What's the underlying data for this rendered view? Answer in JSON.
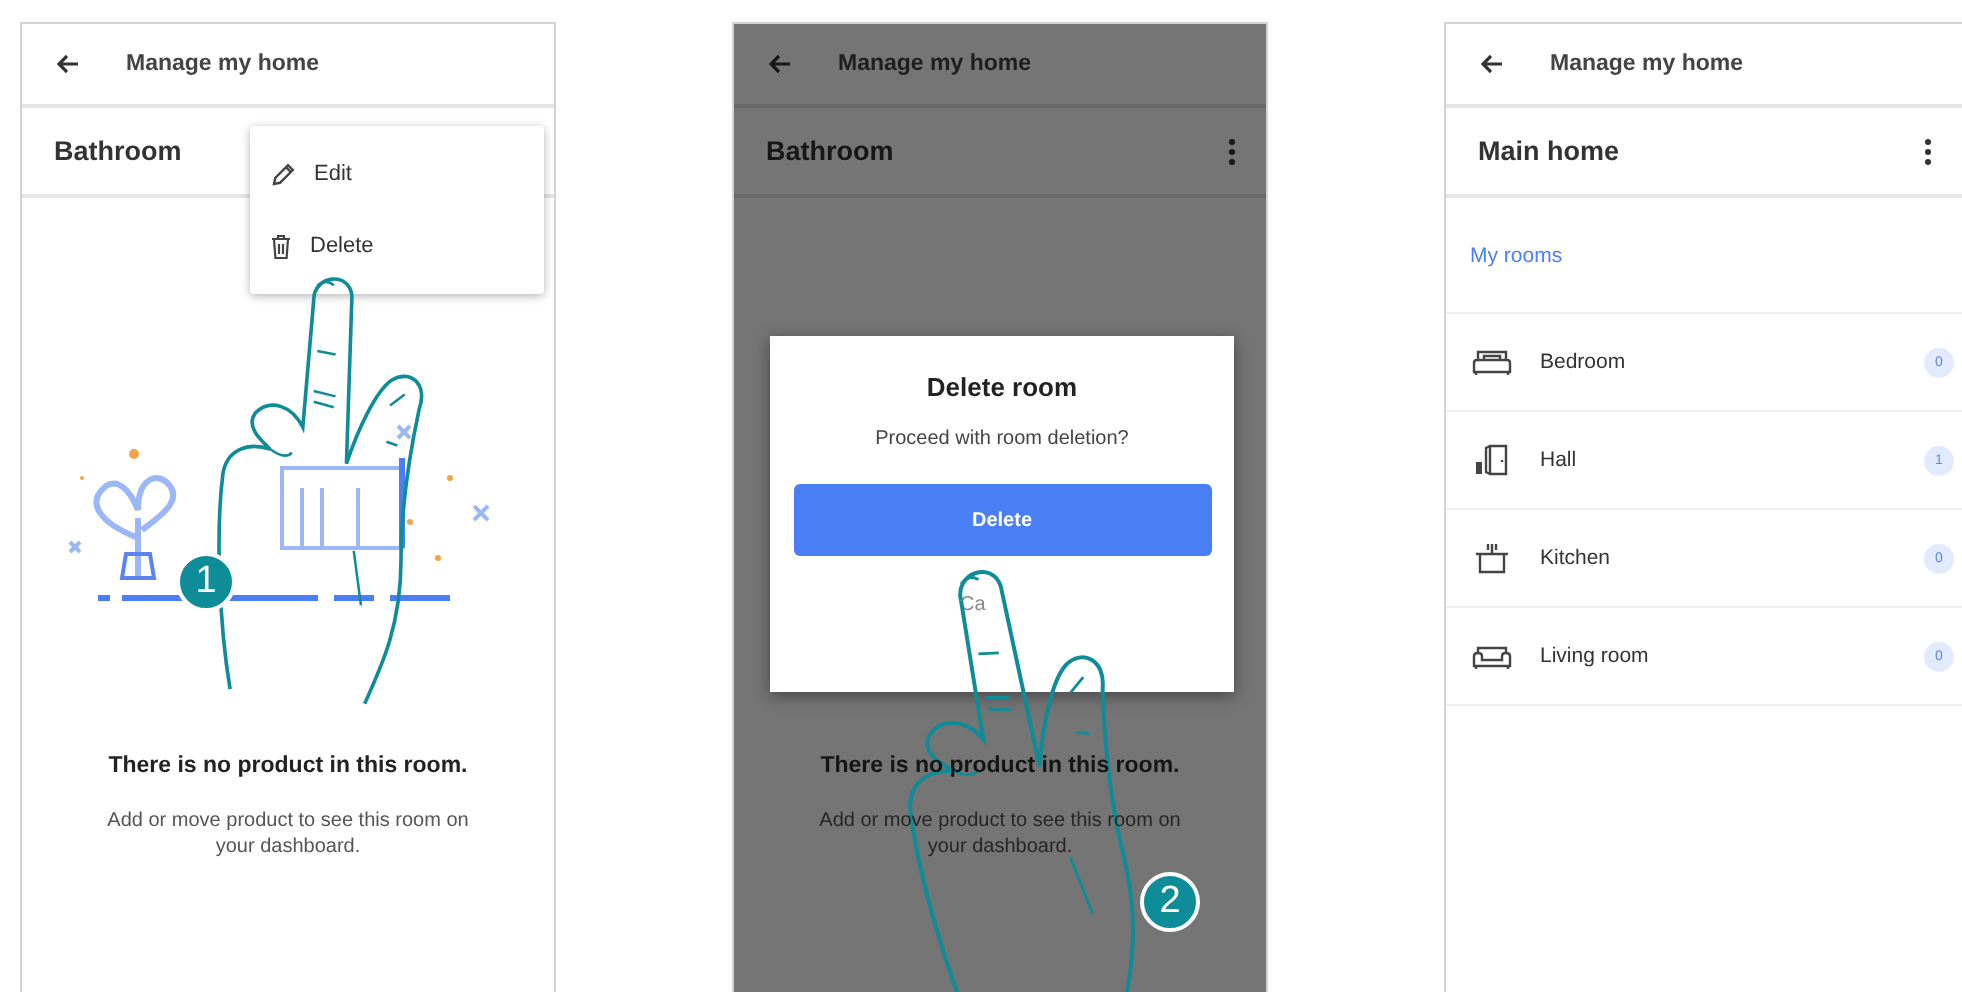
{
  "screens": [
    {
      "kind": "room",
      "header": {
        "title": "Manage my home"
      },
      "title": "Bathroom",
      "menu": [
        {
          "label": "Edit"
        },
        {
          "label": "Delete"
        }
      ],
      "empty_title": "There is no product in this room.",
      "empty_text": "Add or move product to see this room on your dashboard.",
      "step": "1"
    },
    {
      "kind": "room",
      "header": {
        "title": "Manage my home"
      },
      "title": "Bathroom",
      "dimmed": true,
      "dialog": {
        "title": "Delete room",
        "message": "Proceed with room deletion?",
        "confirm": "Delete",
        "cancel": "Ca"
      },
      "empty_title": "There is no product in this room.",
      "empty_text": "Add or move product to see this room on your dashboard.",
      "step": "2"
    },
    {
      "kind": "home",
      "header": {
        "title": "Manage my home"
      },
      "title": "Main home",
      "section": "My rooms",
      "rooms": [
        {
          "name": "Bedroom",
          "count": "0"
        },
        {
          "name": "Hall",
          "count": "1"
        },
        {
          "name": "Kitchen",
          "count": "0"
        },
        {
          "name": "Living room",
          "count": "0"
        }
      ]
    }
  ]
}
